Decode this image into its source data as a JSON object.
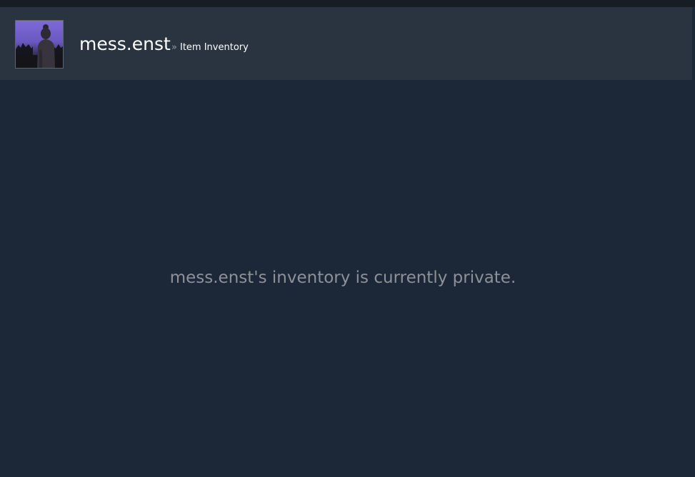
{
  "profile": {
    "persona_name": "mess.enst",
    "breadcrumb_separator": "»",
    "breadcrumb_page": "Item Inventory"
  },
  "inventory": {
    "private_message": "mess.enst's inventory is currently private."
  },
  "colors": {
    "background": "#1b2838",
    "header": "#2a3440",
    "name_text": "#ffffff",
    "message_text": "#8c919a"
  }
}
